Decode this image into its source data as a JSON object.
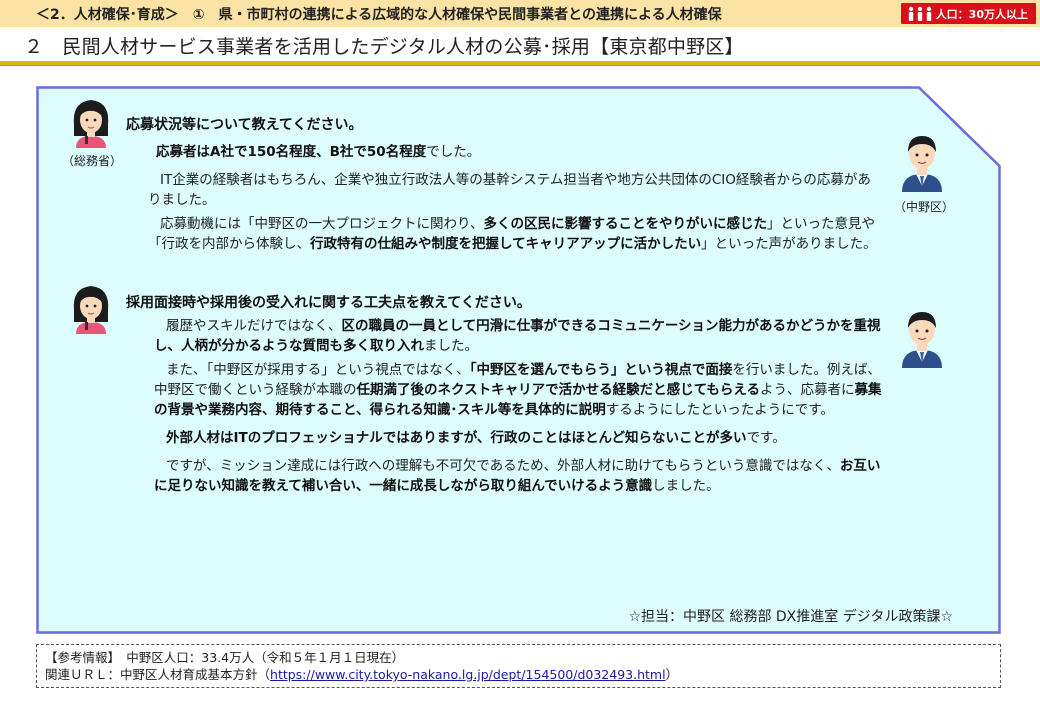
{
  "header": {
    "breadcrumb": "＜2．人材確保･育成＞　①　県・市町村の連携による広域的な人材確保や民間事業者との連携による人材確保",
    "population_badge": "人口：30万人以上",
    "title": "２　民間人材サービス事業者を活用したデジタル人材の公募･採用【東京都中野区】"
  },
  "roles": {
    "interviewer": "（総務省）",
    "respondent": "（中野区）"
  },
  "section1": {
    "question": "応募状況等について教えてください。",
    "p1_bold": "応募者はA社で150名程度、B社で50名程度",
    "p1_tail": "でした。",
    "p2": "IT企業の経験者はもちろん、企業や独立行政法人等の基幹システム担当者や地方公共団体のCIO経験者からの応募がありました。",
    "p3_a": "応募動機には「中野区の一大プロジェクトに関わり、",
    "p3_b": "多くの区民に影響することをやりがいに感じた",
    "p3_c": "」といった意見や「行政を内部から体験し、",
    "p3_d": "行政特有の仕組みや制度を把握してキャリアアップに活かしたい",
    "p3_e": "」といった声がありました。"
  },
  "section2": {
    "question": "採用面接時や採用後の受入れに関する工夫点を教えてください。",
    "p1_a": "履歴やスキルだけではなく、",
    "p1_b": "区の職員の一員として円滑に仕事ができるコミュニケーション能力があるかどうかを重視し、人柄が分かるような質問も多く取り入れ",
    "p1_c": "ました。",
    "p2_a": "また、「中野区が採用する」という視点ではなく、",
    "p2_b": "「中野区を選んでもらう」という視点で面接",
    "p2_c": "を行いました。例えば、中野区で働くという経験が本職の",
    "p2_d": "任期満了後のネクストキャリアで活かせる経験だと感じてもらえる",
    "p2_e": "よう、応募者に",
    "p2_f": "募集の背景や業務内容、期待すること、得られる知識･スキル等を具体的に説明",
    "p2_g": "するようにしたといったようにです。",
    "p3_bold": "外部人材はITのプロフェッショナルではありますが、行政のことはほとんど知らないことが多い",
    "p3_tail": "です。",
    "p4_a": "ですが、ミッション達成には行政への理解も不可欠であるため、外部人材に助けてもらうという意識ではなく、",
    "p4_b": "お互いに足りない知識を教えて補い合い、一緒に成長しながら取り組んでいけるよう意識",
    "p4_c": "しました。"
  },
  "contact": "☆担当：中野区 総務部 DX推進室 デジタル政策課☆",
  "reference": {
    "line1": "【参考情報】　中野区人口：33.4万人（令和５年１月１日現在）",
    "line2_prefix": "関連ＵＲＬ：中野区人材育成基本方針（",
    "url": "https://www.city.tokyo-nakano.lg.jp/dept/154500/d032493.html",
    "line2_suffix": "）"
  },
  "colors": {
    "header_band": "#fbe3a6",
    "title_rule": "#e2b11a",
    "panel_fill": "#ddfcfc",
    "panel_border": "#6c6cdc",
    "badge": "#d8101a",
    "link": "#1a1aa8"
  }
}
